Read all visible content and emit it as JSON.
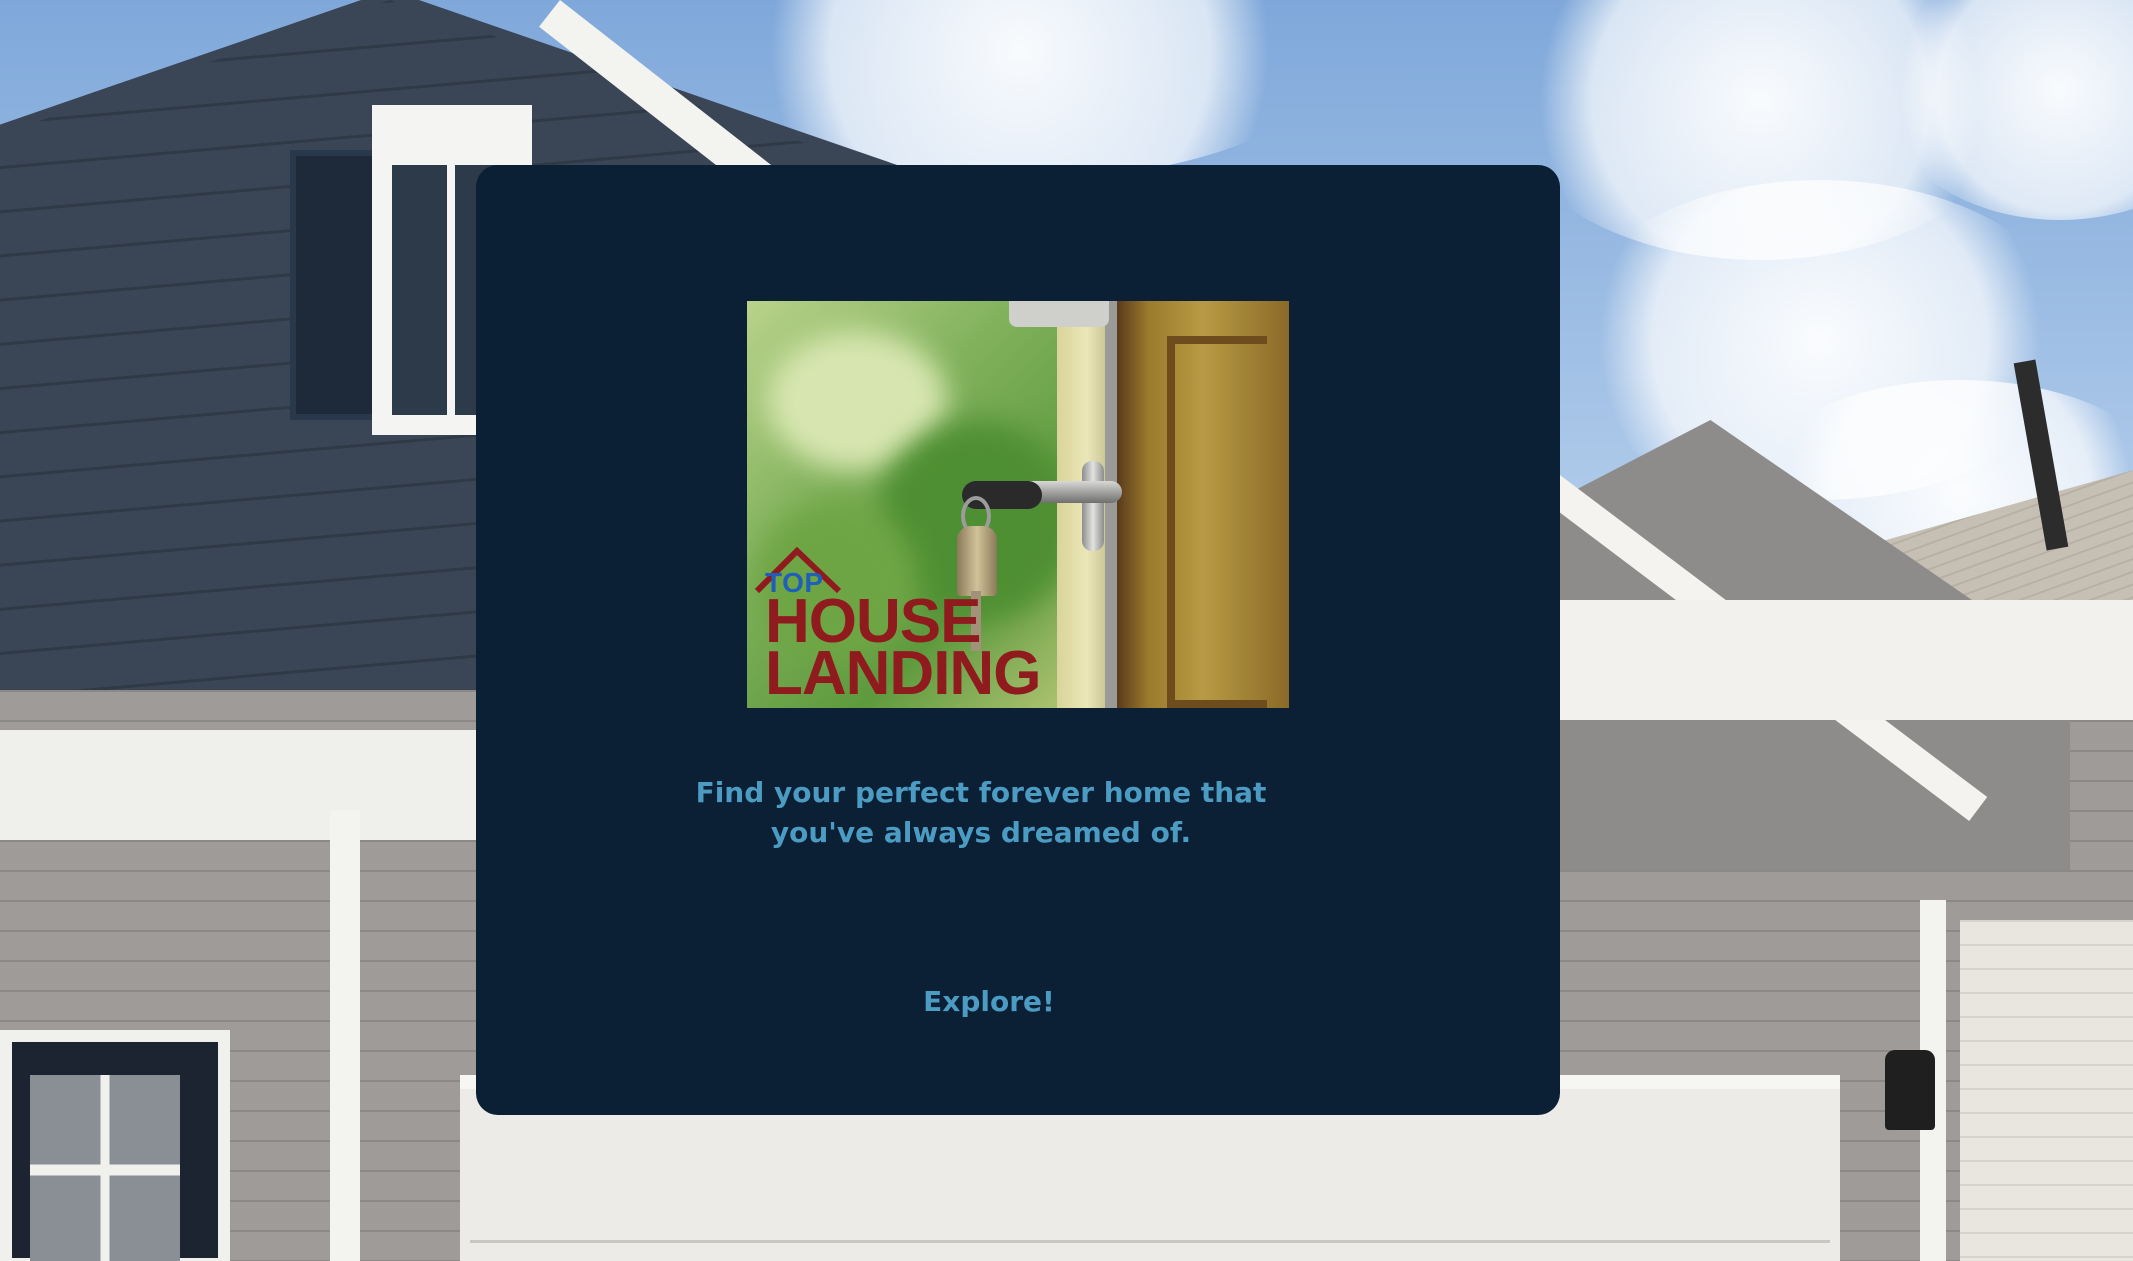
{
  "background": {
    "scene": "house exterior under cloudy blue sky"
  },
  "card": {
    "background_color": "#0b1f35",
    "accent_color": "#4b9bc2"
  },
  "hero": {
    "logo": {
      "top": "TOP",
      "house": "HOUSE",
      "landing": "LANDING",
      "top_color": "#1f5fb9",
      "wordmark_color": "#8f1b1f"
    }
  },
  "tagline": {
    "line1": "Find your perfect forever home that",
    "line2": "you've always dreamed of."
  },
  "cta": {
    "label": "Explore!"
  }
}
